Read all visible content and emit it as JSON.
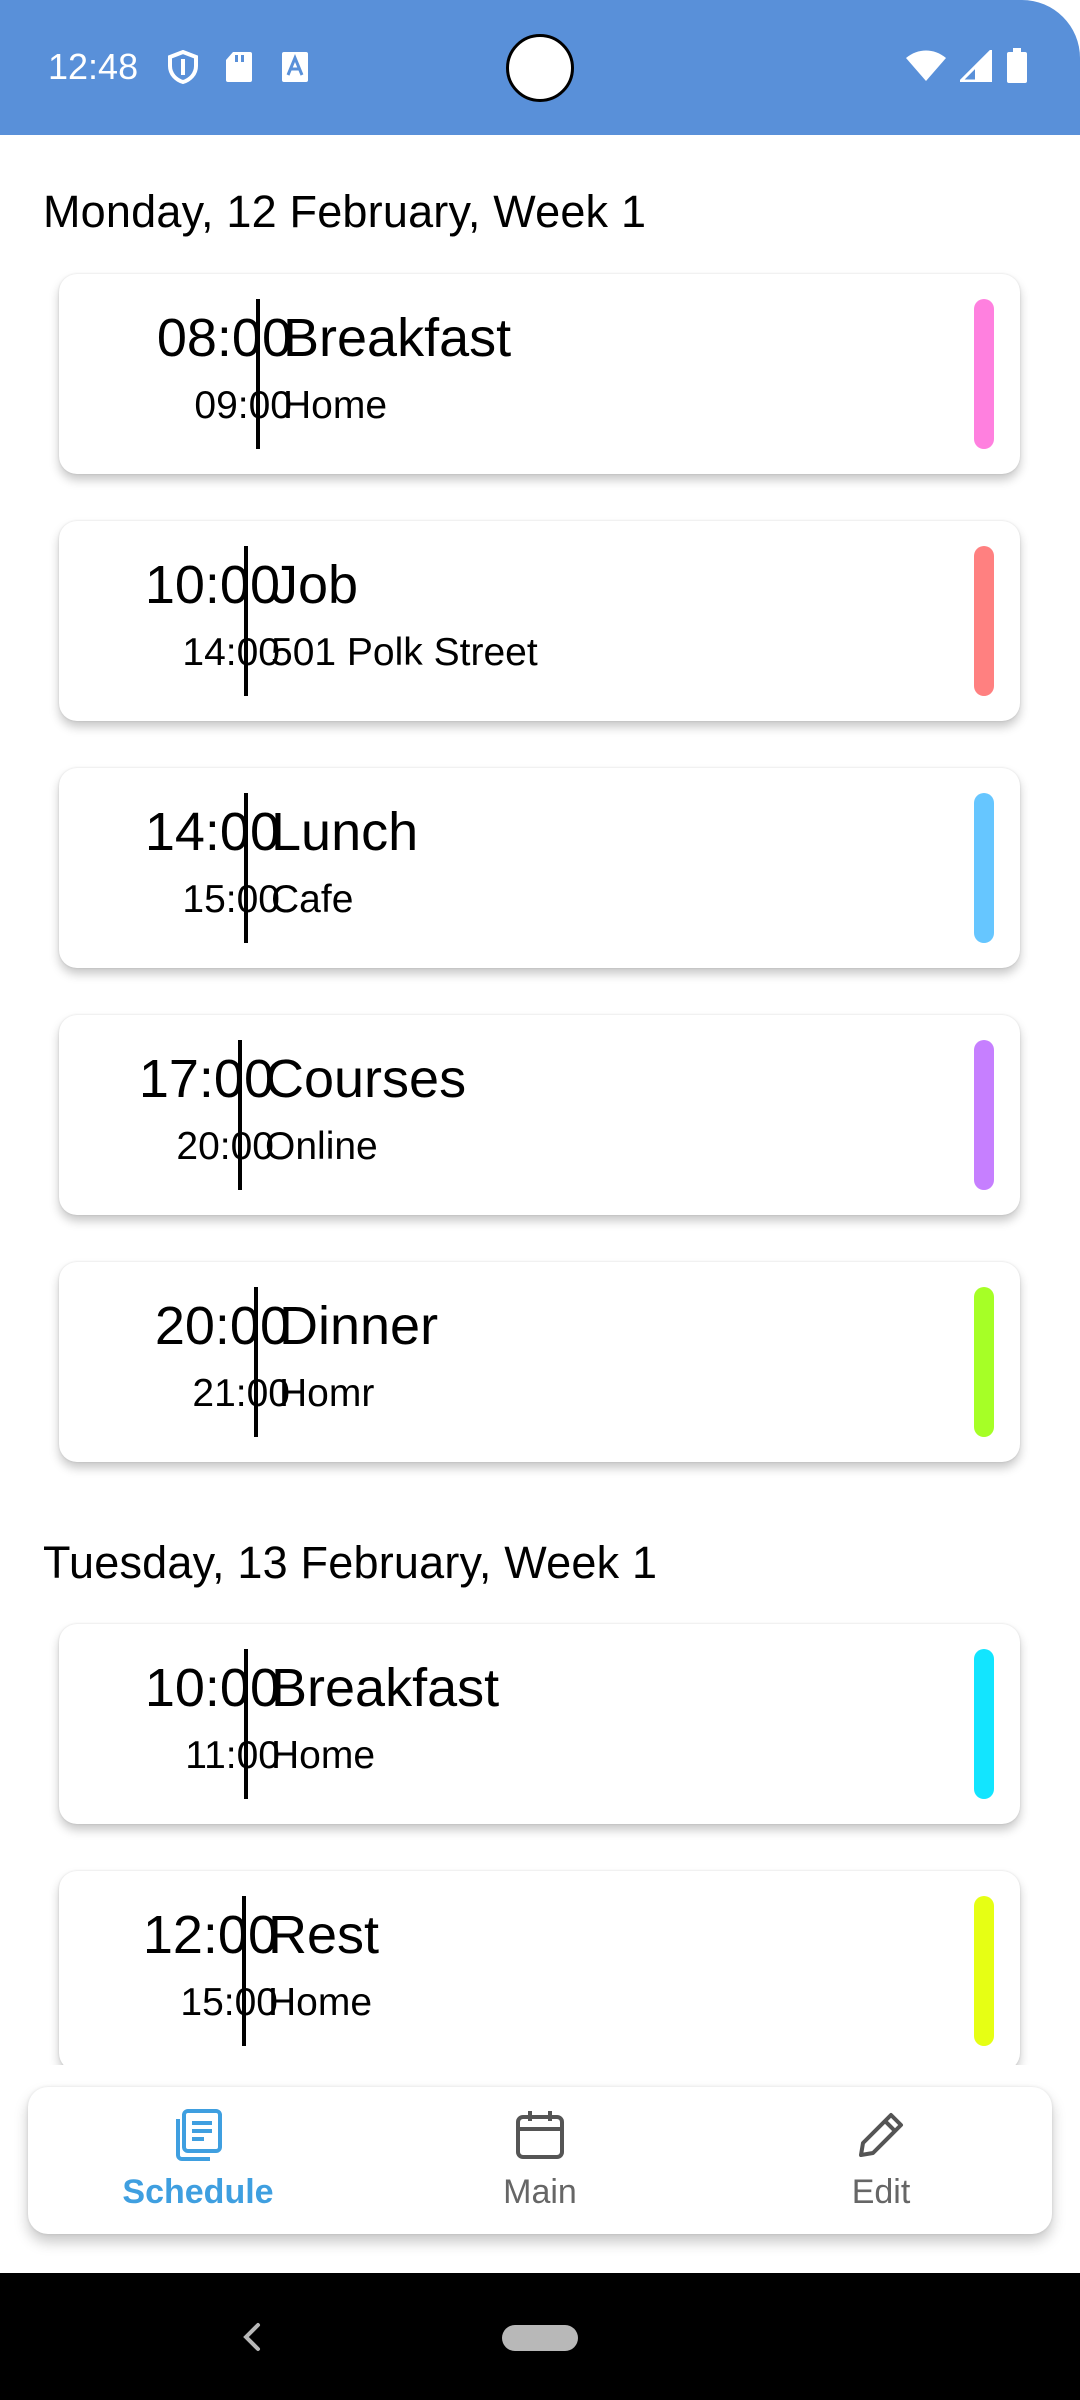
{
  "status_bar": {
    "time": "12:48",
    "left_icons": [
      "shield-icon",
      "sd-card-icon",
      "text-a-icon"
    ],
    "right_icons": [
      "wifi-icon",
      "signal-icon",
      "battery-icon"
    ],
    "color": "#5990D9"
  },
  "schedule": {
    "days": [
      {
        "header": "Monday, 12 February, Week 1",
        "events": [
          {
            "start": "08:00",
            "end": "09:00",
            "title": "Breakfast",
            "place": "Home",
            "color": "#FF80DF"
          },
          {
            "start": "10:00",
            "end": "14:00",
            "title": "Job",
            "place": "501 Polk Street",
            "color": "#FF8080"
          },
          {
            "start": "14:00",
            "end": "15:00",
            "title": "Lunch",
            "place": "Cafe",
            "color": "#66C6FF"
          },
          {
            "start": "17:00",
            "end": "20:00",
            "title": "Courses",
            "place": "Online",
            "color": "#C67FFF"
          },
          {
            "start": "20:00",
            "end": "21:00",
            "title": "Dinner",
            "place": "Homr",
            "color": "#A6FF26"
          }
        ]
      },
      {
        "header": "Tuesday, 13 February, Week 1",
        "events": [
          {
            "start": "10:00",
            "end": "11:00",
            "title": "Breakfast",
            "place": "Home",
            "color": "#12E5FF"
          },
          {
            "start": "12:00",
            "end": "15:00",
            "title": "Rest",
            "place": "Home",
            "color": "#E6FF14"
          }
        ]
      }
    ]
  },
  "bottom_nav": {
    "items": [
      {
        "label": "Schedule",
        "icon": "schedule-list-icon",
        "active": true
      },
      {
        "label": "Main",
        "icon": "calendar-icon",
        "active": false
      },
      {
        "label": "Edit",
        "icon": "pencil-icon",
        "active": false
      }
    ],
    "active_color": "#3F9FE0"
  }
}
